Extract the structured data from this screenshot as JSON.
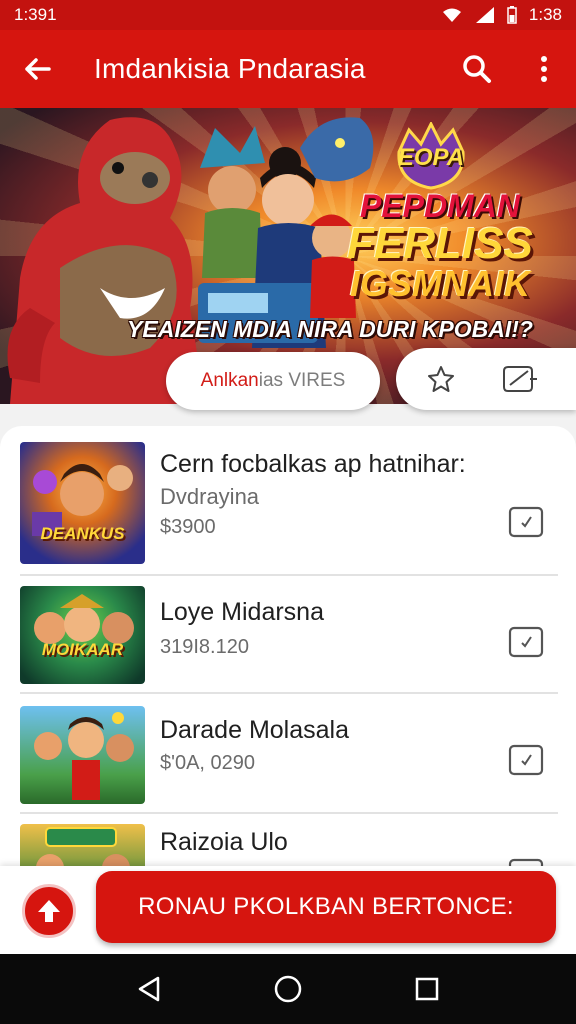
{
  "status_bar": {
    "time_left": "1:391",
    "time_right": "1:38"
  },
  "app_bar": {
    "title": "Imdankisia Pndarasia",
    "back_icon": "back-arrow-icon",
    "search_icon": "search-icon",
    "more_icon": "more-vert-icon"
  },
  "banner": {
    "badge": "EOPA",
    "promo_line1": "PEPDMAN",
    "promo_line2": "FERLISS",
    "promo_line3": "IGSMNAIK",
    "tagline": "YEAIZEN MDIA NIRA DURI KPOBAI!?"
  },
  "pill": {
    "label_red": "Anlkan",
    "label_gray": "ias VIRES"
  },
  "pill_icons": [
    "star-icon",
    "tag-icon"
  ],
  "items": [
    {
      "name": "Cern focbalkas ap hatnihar:",
      "sub": "Dvdrayina",
      "price": "$3900",
      "thumb_text": "DEANKUS"
    },
    {
      "name": "Loye Midarsna",
      "sub": "",
      "price": "319I8.120",
      "thumb_text": "MOIKAAR"
    },
    {
      "name": "Darade Molasala",
      "sub": "",
      "price": "$'0A, 0290",
      "thumb_text": ""
    },
    {
      "name": "Raizoia Ulo",
      "sub": "",
      "price": "",
      "thumb_text": ""
    }
  ],
  "bottom_bar": {
    "button_label": "RONAU PKOLKBAN BERTONCE:",
    "round_icon": "upload-arrow-icon"
  },
  "nav_bar": {
    "icons": [
      "nav-back-icon",
      "nav-home-icon",
      "nav-recents-icon"
    ]
  },
  "colors": {
    "primary": "#d6150f",
    "status": "#c3120f",
    "text": "#202020",
    "muted": "#6b6b6b"
  }
}
